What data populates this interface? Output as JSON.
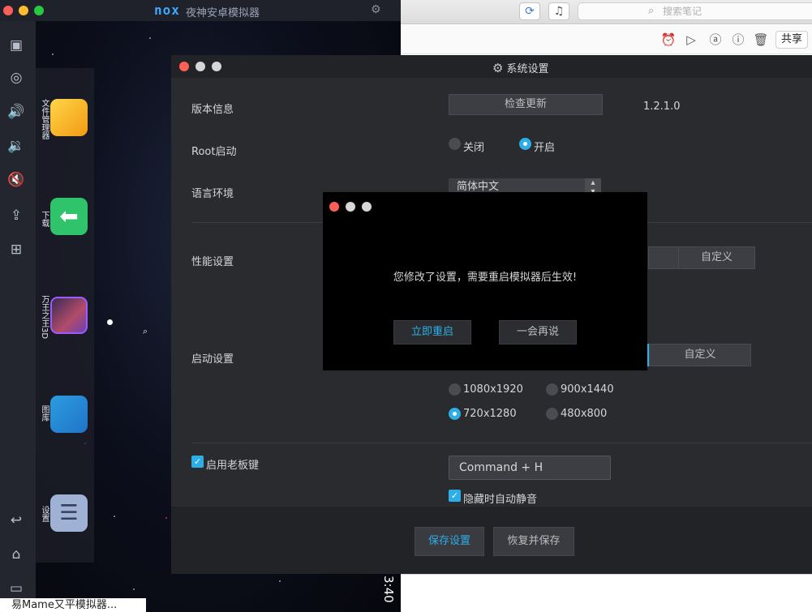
{
  "notes_app": {
    "search_placeholder": "搜索笔记",
    "share_label": "共享",
    "toolbar_icons": [
      "refresh-icon",
      "bell-icon",
      "alarm-icon",
      "present-icon",
      "at-icon",
      "info-icon",
      "trash-icon"
    ]
  },
  "emulator": {
    "brand": "nox",
    "title": "夜神安卓模拟器",
    "clock": "3:40",
    "apps": [
      {
        "label": "文件管理器"
      },
      {
        "label": "下载"
      },
      {
        "label": "万王之王3D"
      },
      {
        "label": "图库"
      },
      {
        "label": "设置"
      }
    ],
    "bottom_text": "易Mame又平模拟器..."
  },
  "settings": {
    "title": "系统设置",
    "version_label": "版本信息",
    "check_update_label": "检查更新",
    "version_value": "1.2.1.0",
    "root_label": "Root启动",
    "root_off_label": "关闭",
    "root_on_label": "开启",
    "language_label": "语言环境",
    "language_value": "简体中文",
    "performance_label": "性能设置",
    "perf_custom_label": "自定义",
    "startup_label": "启动设置",
    "startup_custom_label": "自定义",
    "resolutions": [
      "1080x1920",
      "900x1440",
      "720x1280",
      "480x800"
    ],
    "selected_resolution": "720x1280",
    "boss_key_label": "启用老板键",
    "hotkey_value": "Command + H",
    "mute_label": "隐藏时自动静音",
    "save_label": "保存设置",
    "reset_label": "恢复并保存"
  },
  "modal": {
    "message": "您修改了设置，需要重启模拟器后生效!",
    "restart_label": "立即重启",
    "later_label": "一会再说"
  },
  "colors": {
    "accent": "#2eaee6",
    "traffic_red": "#fe5f57",
    "traffic_yellow": "#febc2e",
    "traffic_green": "#28c840"
  }
}
